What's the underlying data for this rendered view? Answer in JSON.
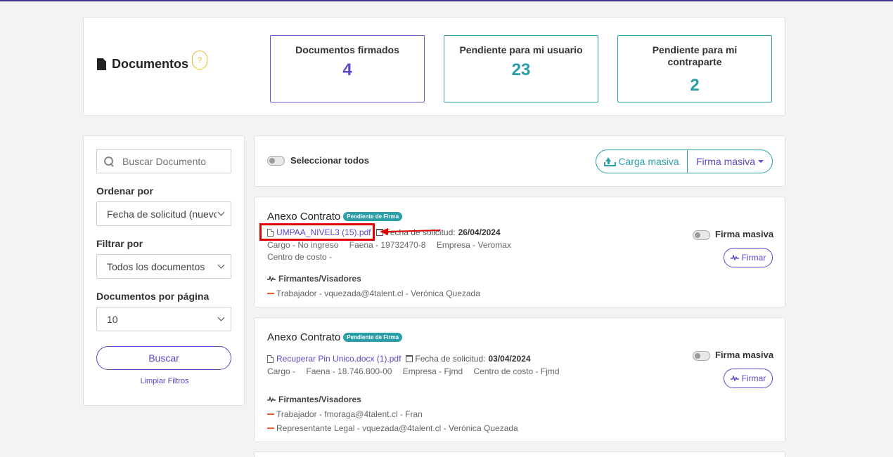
{
  "header": {
    "title": "Documentos",
    "help": "?",
    "stats": [
      {
        "label": "Documentos firmados",
        "value": "4"
      },
      {
        "label": "Pendiente para mi usuario",
        "value": "23"
      },
      {
        "label": "Pendiente para mi contraparte",
        "value": "2"
      }
    ]
  },
  "filters": {
    "search_placeholder": "Buscar Documento",
    "order_label": "Ordenar por",
    "order_value": "Fecha de solicitud (nuevo",
    "filter_label": "Filtrar por",
    "filter_value": "Todos los documentos",
    "per_page_label": "Documentos por página",
    "per_page_value": "10",
    "search_button": "Buscar",
    "clear_link": "Limpiar Filtros"
  },
  "toolbar": {
    "select_all": "Seleccionar todos",
    "carga_masiva": "Carga masiva",
    "firma_masiva": "Firma masiva"
  },
  "documents": [
    {
      "title": "Anexo Contrato",
      "badge": "Pendiente de Firma",
      "file": "UMPAA_NIVEL3 (15).pdf",
      "fecha_label": "Fecha de solicitud:",
      "fecha": "26/04/2024",
      "cargo": "Cargo - No ingreso",
      "faena": "Faena - 19732470-8",
      "empresa": "Empresa - Veromax",
      "centro": "Centro de costo -",
      "firmantes_label": "Firmantes/Visadores",
      "signers": [
        "Trabajador - vquezada@4talent.cl - Verónica Quezada"
      ],
      "firma_masiva": "Firma masiva",
      "firmar": "Firmar"
    },
    {
      "title": "Anexo Contrato",
      "badge": "Pendiente de Firma",
      "file": "Recuperar Pin Unico.docx (1).pdf",
      "fecha_label": "Fecha de solicitud:",
      "fecha": "03/04/2024",
      "cargo": "Cargo -",
      "faena": "Faena - 18.746.800-00",
      "empresa": "Empresa - Fjmd",
      "centro": "Centro de costo - Fjmd",
      "firmantes_label": "Firmantes/Visadores",
      "signers": [
        "Trabajador - fmoraga@4talent.cl - Fran",
        "Representante Legal - vquezada@4talent.cl - Verónica Quezada"
      ],
      "firma_masiva": "Firma masiva",
      "firmar": "Firmar"
    }
  ]
}
